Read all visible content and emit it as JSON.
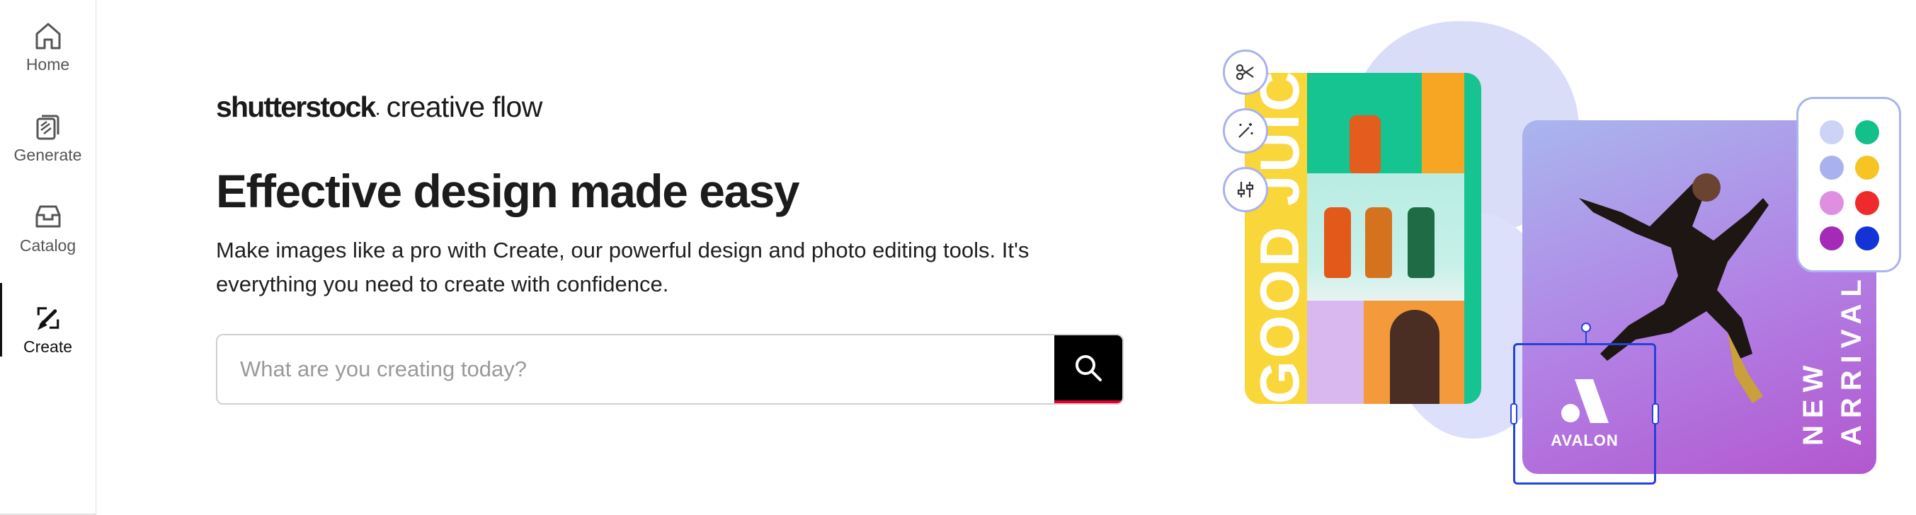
{
  "sidebar": {
    "items": [
      {
        "label": "Home",
        "icon": "home-icon",
        "active": false
      },
      {
        "label": "Generate",
        "icon": "generate-icon",
        "active": false
      },
      {
        "label": "Catalog",
        "icon": "catalog-icon",
        "active": false
      },
      {
        "label": "Create",
        "icon": "create-icon",
        "active": true
      }
    ]
  },
  "hero": {
    "logo_brand": "shutterstock",
    "logo_product": "creative flow",
    "headline": "Effective design made easy",
    "subhead": "Make images like a pro with Create, our powerful design and photo editing tools. It's everything you need to create with confidence.",
    "search_placeholder": "What are you creating today?",
    "search_value": ""
  },
  "illustration": {
    "juice_card_text": "GOOD JUICE",
    "arrival_card_text": "NEW ARRIVAL",
    "logo_text": "AVALON",
    "tools": [
      "scissors-icon",
      "magic-wand-icon",
      "adjust-sliders-icon"
    ],
    "swatches": [
      "#cdd3f5",
      "#14c08a",
      "#a9b2ee",
      "#f6c523",
      "#de8fe0",
      "#f02a2a",
      "#a32bb8",
      "#1433d6"
    ]
  },
  "colors": {
    "accent_red": "#e4002b",
    "search_button": "#000000",
    "purple_card": "#b26ae0",
    "yellow_card": "#f9d63a",
    "frame_blue": "#2742d9"
  }
}
